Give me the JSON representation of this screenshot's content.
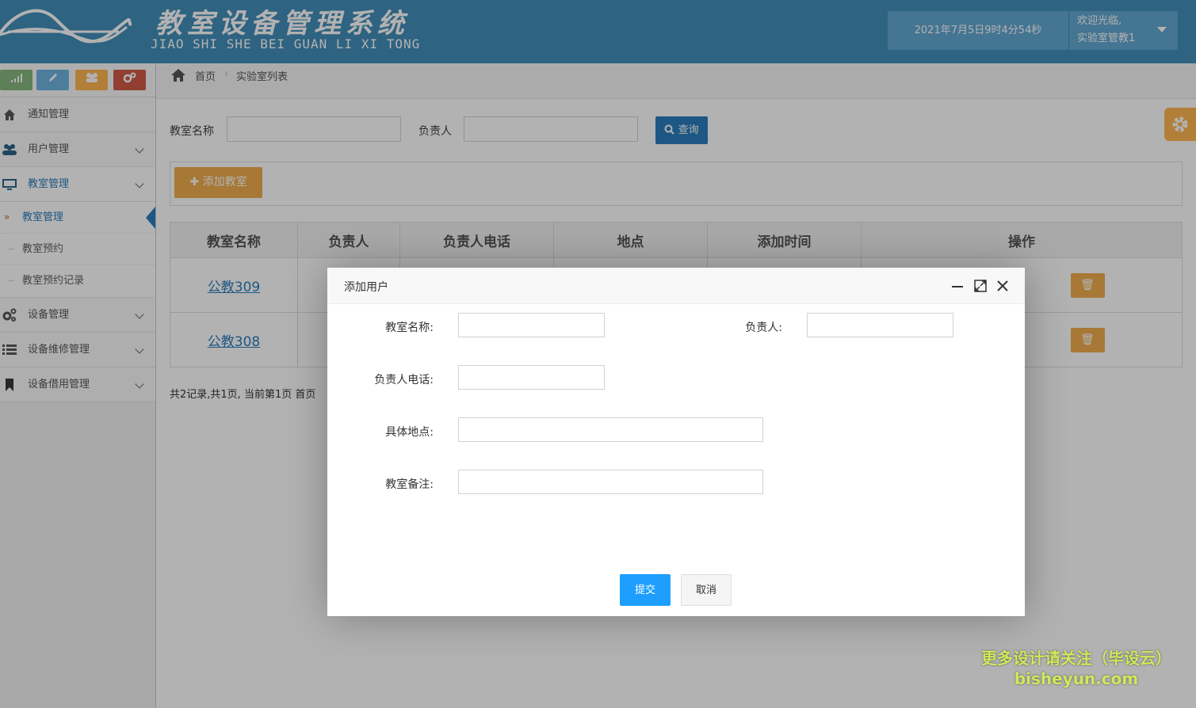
{
  "header": {
    "title": "教室设备管理系统",
    "subtitle": "JIAO SHI SHE BEI GUAN LI XI TONG",
    "datetime": "2021年7月5日9时4分54秒",
    "welcome": "欢迎光临,",
    "username": "实验室管教1"
  },
  "shortcuts": [
    {
      "icon": "signal-icon",
      "color": "#87b87f"
    },
    {
      "icon": "pencil-icon",
      "color": "#6fb3e0"
    },
    {
      "icon": "users-icon",
      "color": "#ffb752"
    },
    {
      "icon": "cogs-icon",
      "color": "#d15b47"
    }
  ],
  "sidebar": {
    "items": [
      {
        "label": "通知管理",
        "icon": "home-icon"
      },
      {
        "label": "用户管理",
        "icon": "users-icon"
      },
      {
        "label": "教室管理",
        "icon": "desktop-icon"
      },
      {
        "label": "设备管理",
        "icon": "cogs-icon"
      },
      {
        "label": "设备维修管理",
        "icon": "list-icon"
      },
      {
        "label": "设备借用管理",
        "icon": "bookmark-icon"
      }
    ],
    "sub_items": [
      "教室管理",
      "教室预约",
      "教室预约记录"
    ]
  },
  "breadcrumb": {
    "home": "首页",
    "current": "实验室列表"
  },
  "search": {
    "name_label": "教室名称",
    "owner_label": "负责人",
    "query_label": "查询"
  },
  "toolbar": {
    "add_label": "添加教室"
  },
  "table": {
    "headers": [
      "教室名称",
      "负责人",
      "负责人电话",
      "地点",
      "添加时间",
      "操作"
    ],
    "rows": [
      {
        "name": "公教309"
      },
      {
        "name": "公教308"
      }
    ]
  },
  "pager": {
    "text": "共2记录,共1页, 当前第1页 首页"
  },
  "modal": {
    "title": "添加用户",
    "fields": {
      "name": "教室名称:",
      "owner": "负责人:",
      "phone": "负责人电话:",
      "location": "具体地点:",
      "remark": "教室备注:"
    },
    "submit": "提交",
    "cancel": "取消"
  },
  "watermark": {
    "line1": "更多设计请关注（毕设云）",
    "line2": "bisheyun.com"
  },
  "colors": {
    "primary": "#438eb9",
    "accent": "#2b7dbc",
    "warning": "#f0ad4e",
    "submit": "#1e9fff"
  }
}
